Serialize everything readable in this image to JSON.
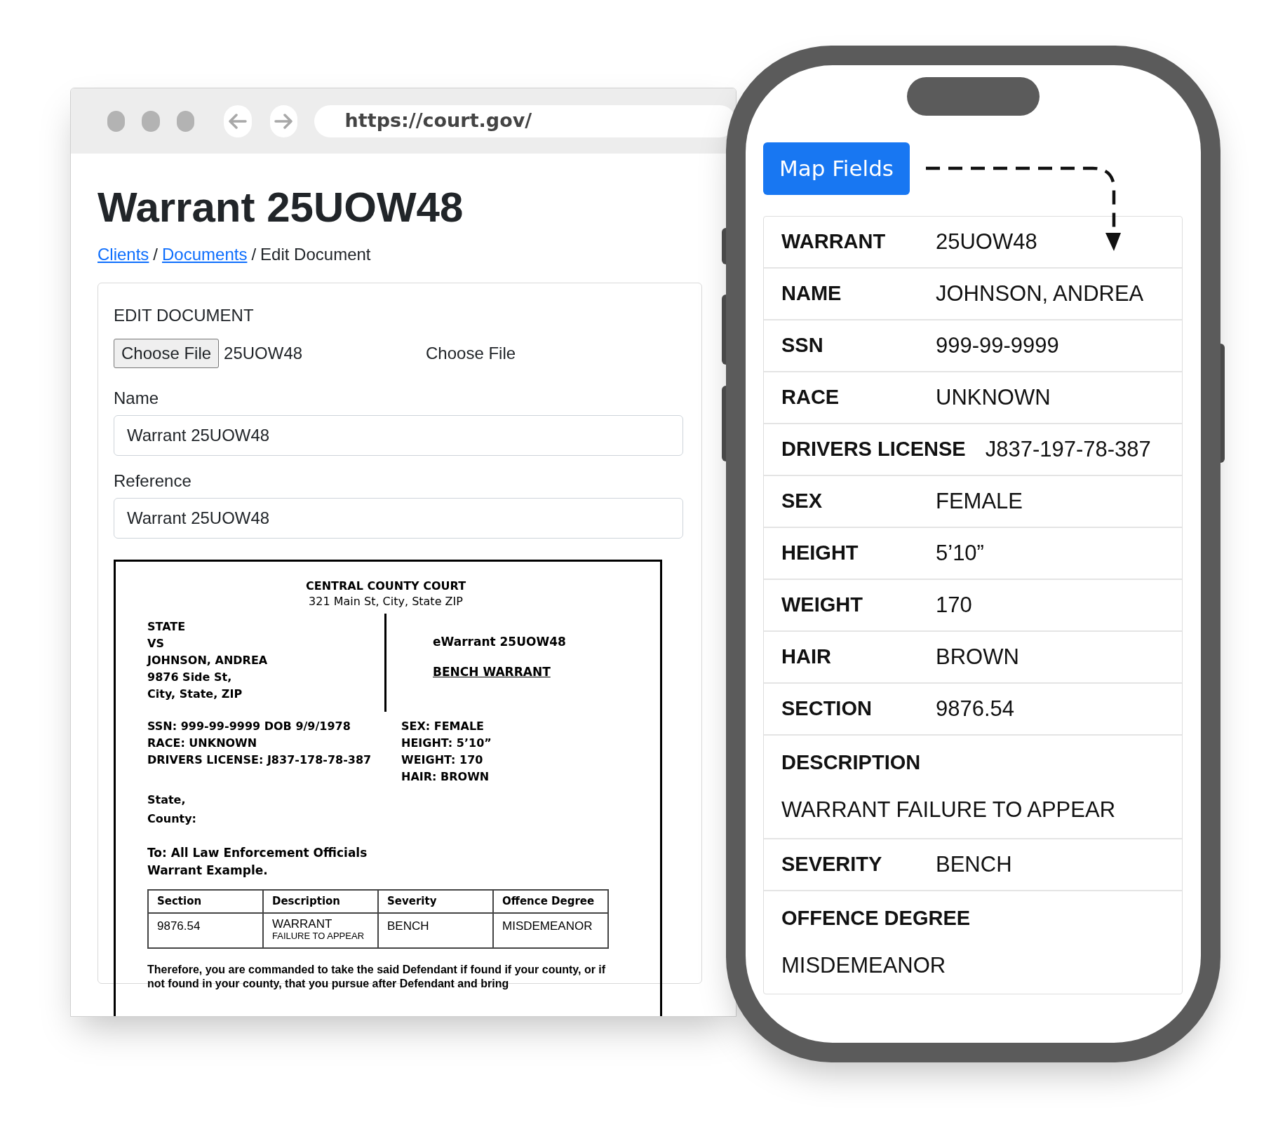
{
  "browser": {
    "url": "https://court.gov/",
    "title": "Warrant 25UOW48",
    "breadcrumb": [
      {
        "text": "Clients",
        "link": true
      },
      {
        "text": "Documents",
        "link": true
      },
      {
        "text": "Edit Document",
        "link": false
      }
    ],
    "separator": "/",
    "card": {
      "heading": "EDIT DOCUMENT",
      "file_button": "Choose File",
      "file_name": "25UOW48",
      "file_label": "Choose File",
      "fields": [
        {
          "label": "Name",
          "value": "Warrant 25UOW48"
        },
        {
          "label": "Reference",
          "value": "Warrant 25UOW48"
        }
      ]
    },
    "document": {
      "court": "CENTRAL COUNTY COURT",
      "address": "321 Main St, City, State ZIP",
      "parties": [
        "STATE",
        "VS",
        "JOHNSON, ANDREA",
        "9876 Side St,",
        "City, State, ZIP"
      ],
      "ewarrant": "eWarrant 25UOW48",
      "warrant_type": "BENCH WARRANT",
      "left_details": [
        "SSN: 999-99-9999 DOB 9/9/1978",
        "RACE: UNKNOWN",
        "DRIVERS LICENSE: J837-178-78-387"
      ],
      "right_details": [
        "SEX: FEMALE",
        "HEIGHT: 5’10”",
        "WEIGHT: 170",
        "HAIR: BROWN"
      ],
      "jurisdiction": [
        "State,",
        "County:"
      ],
      "addressee": [
        "To: All Law Enforcement Officials",
        "Warrant Example."
      ],
      "table": {
        "columns": [
          "Section",
          "Description",
          "Severity",
          "Offence Degree"
        ],
        "rows": [
          [
            {
              "text": "9876.54"
            },
            {
              "text": "WARRANT",
              "note": "FAILURE TO APPEAR"
            },
            {
              "text": "BENCH"
            },
            {
              "text": "MISDEMEANOR"
            }
          ]
        ]
      },
      "closing": "Therefore, you are commanded to take the said Defendant if found if your county, or if not found in your county, that you pursue after Defendant and bring"
    }
  },
  "phone": {
    "button": "Map Fields",
    "fields": [
      {
        "label": "WARRANT",
        "value": "25UOW48",
        "kind": "inline"
      },
      {
        "label": "NAME",
        "value": "JOHNSON, ANDREA",
        "kind": "inline"
      },
      {
        "label": "SSN",
        "value": "999-99-9999",
        "kind": "inline"
      },
      {
        "label": "RACE",
        "value": "UNKNOWN",
        "kind": "inline"
      },
      {
        "label": "DRIVERS LICENSE",
        "value": "J837-197-78-387",
        "kind": "inline"
      },
      {
        "label": "SEX",
        "value": "FEMALE",
        "kind": "inline"
      },
      {
        "label": "HEIGHT",
        "value": "5’10”",
        "kind": "inline"
      },
      {
        "label": "WEIGHT",
        "value": "170",
        "kind": "inline"
      },
      {
        "label": "HAIR",
        "value": "BROWN",
        "kind": "inline"
      },
      {
        "label": "SECTION",
        "value": "9876.54",
        "kind": "inline"
      },
      {
        "label": "DESCRIPTION",
        "value": "WARRANT FAILURE TO APPEAR",
        "kind": "stacked"
      },
      {
        "label": "SEVERITY",
        "value": "BENCH",
        "kind": "inline"
      },
      {
        "label": "OFFENCE DEGREE",
        "value": "MISDEMEANOR",
        "kind": "stacked"
      }
    ]
  }
}
